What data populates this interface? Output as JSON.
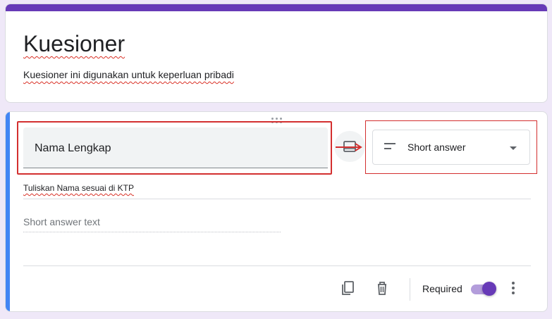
{
  "form": {
    "title": "Kuesioner",
    "description": "Kuesioner ini digunakan untuk keperluan pribadi",
    "accent_color": "#673ab7"
  },
  "question": {
    "title": "Nama Lengkap",
    "description": "Tuliskan Nama sesuai di KTP",
    "type_label": "Short answer",
    "answer_placeholder": "Short answer text",
    "required_label": "Required",
    "required": true,
    "accent_color": "#4285f4"
  },
  "icons": {
    "image": "image-icon",
    "short_answer": "short-answer-icon",
    "dropdown": "chevron-down-icon",
    "copy": "copy-icon",
    "delete": "trash-icon",
    "more": "more-vert-icon",
    "drag": "drag-handle-icon"
  },
  "annotations": {
    "highlight_color": "#d32f2f"
  }
}
